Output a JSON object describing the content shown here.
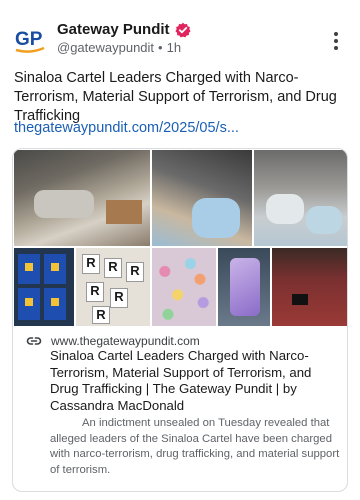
{
  "post": {
    "author_name": "Gateway Pundit",
    "handle": "@gatewaypundit",
    "separator": "•",
    "time_ago": "1h",
    "text": "Sinaloa Cartel Leaders Charged with Narco-Terrorism, Material Support of Terrorism, and Drug Trafficking",
    "link": "thegatewaypundit.com/2025/05/s..."
  },
  "avatar": {
    "logo_text": "GP",
    "brand_color": "#1a4da1",
    "accent_color": "#f0a020"
  },
  "verified": {
    "color": "#e0245e"
  },
  "link_card": {
    "domain": "www.thegatewaypundit.com",
    "title": "Sinaloa Cartel Leaders Charged with Narco-Terrorism, Material Support of Terrorism, and Drug Trafficking | The Gateway Pundit | by Cassandra MacDonald",
    "description": "An indictment unsealed on Tuesday revealed that alleged leaders of the Sinaloa Cartel have been charged with narco-terrorism, drug trafficking, and material support of terrorism.",
    "images": [
      "packaged-drugs-in-vehicle-photo",
      "drugs-in-car-console-photo",
      "drug-bags-in-trunk-photo",
      "blue-packages-photo",
      "branded-bricks-photo",
      "colorful-pills-photo",
      "purple-vape-photo",
      "red-beanie-photo"
    ]
  }
}
